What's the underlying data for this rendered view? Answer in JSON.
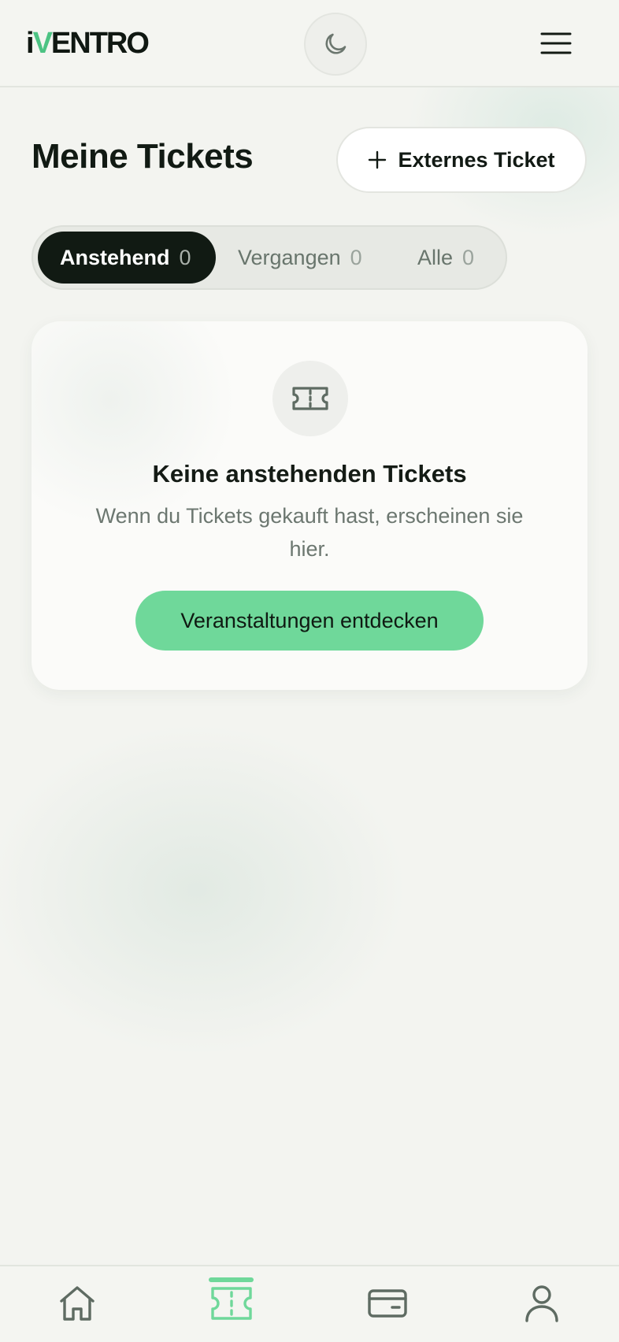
{
  "app": {
    "logo_prefix": "i",
    "logo_v": "V",
    "logo_rest": "ENTRO"
  },
  "header": {
    "theme_toggle_icon": "moon-icon",
    "menu_icon": "hamburger-menu-icon"
  },
  "page": {
    "title": "Meine Tickets",
    "external_ticket_label": "Externes Ticket"
  },
  "tabs": [
    {
      "label": "Anstehend",
      "count": "0",
      "active": true
    },
    {
      "label": "Vergangen",
      "count": "0",
      "active": false
    },
    {
      "label": "Alle",
      "count": "0",
      "active": false
    }
  ],
  "empty_state": {
    "icon": "ticket-icon",
    "title": "Keine anstehenden Tickets",
    "description": "Wenn du Tickets gekauft hast, erscheinen sie hier.",
    "button_label": "Veranstaltungen entdecken"
  },
  "bottom_nav": {
    "items": [
      {
        "icon": "home-icon",
        "active": false
      },
      {
        "icon": "ticket-icon",
        "active": true
      },
      {
        "icon": "wallet-card-icon",
        "active": false
      },
      {
        "icon": "user-icon",
        "active": false
      }
    ]
  },
  "colors": {
    "accent": "#6fd89a",
    "logo_accent": "#4cc383",
    "dark": "#111a13",
    "background": "#f3f4f0"
  }
}
